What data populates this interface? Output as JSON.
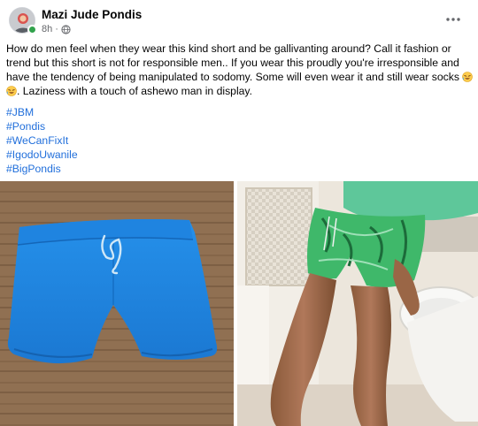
{
  "post": {
    "author": "Mazi Jude Pondis",
    "timestamp": "8h",
    "visibility_icon": "globe-icon",
    "more_icon": "more-horizontal-icon",
    "text_parts": [
      "How do men feel when they wear this kind short and be gallivanting around? Call it fashion or trend but this short is not for responsible men.. If you wear this proudly you're irresponsible and have the tendency of being manipulated to sodomy. Some will even wear it and still wear socks ",
      ". Laziness with a touch of ashewo man in display."
    ],
    "emoji_icon": "rofl-emoji-icon",
    "hashtags": [
      "#JBM",
      "#Pondis",
      "#WeCanFixIt",
      "#IgodoUwanile",
      "#BigPondis"
    ],
    "photos": [
      {
        "name": "blue-shorts-photo"
      },
      {
        "name": "green-shorts-photo"
      }
    ]
  },
  "colors": {
    "hashtag": "#216fdb",
    "meta": "#65676b",
    "online": "#31a24c",
    "shorts_blue": "#1e88e5",
    "shorts_green": "#3fb86a"
  }
}
